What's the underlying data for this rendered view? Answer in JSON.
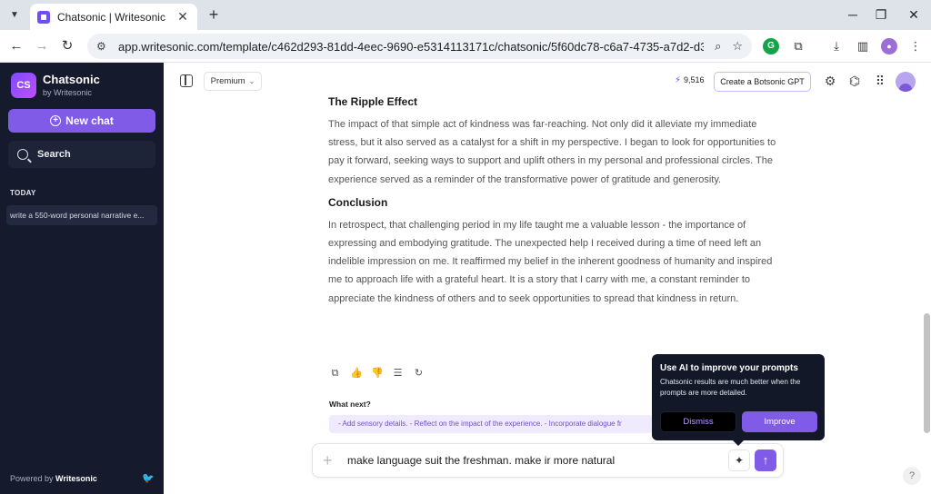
{
  "browser": {
    "tab_title": "Chatsonic | Writesonic",
    "close_glyph": "✕",
    "new_tab_glyph": "+",
    "url": "app.writesonic.com/template/c462d293-81dd-4eec-9690-e5314113171c/chatsonic/5f60dc78-c6a7-4735-a7d2-d399b8594a25?l_...",
    "icons": {
      "tab_list": "chevron-down-icon",
      "back": "arrow-left-icon",
      "forward": "arrow-right-icon",
      "reload": "reload-icon",
      "site_info": "tune-icon",
      "zoom": "search-icon",
      "bookmark": "star-icon",
      "grammarly": "grammarly-icon",
      "extensions": "puzzle-icon",
      "downloads": "download-icon",
      "side_panel": "side-panel-icon",
      "profile": "profile-icon",
      "menu": "kebab-icon"
    }
  },
  "sidebar": {
    "logo": "CS",
    "brand_name": "Chatsonic",
    "brand_sub": "by Writesonic",
    "new_chat_label": "New chat",
    "search_label": "Search",
    "section_today": "TODAY",
    "history": [
      {
        "title": "write a 550-word personal narrative e..."
      }
    ],
    "powered_prefix": "Powered by ",
    "powered_brand": "Writesonic"
  },
  "topbar": {
    "plan_label": "Premium",
    "credits": "9,516",
    "botsonic_label": "Create a Botsonic GPT",
    "icons": [
      "gear-icon",
      "share-icon",
      "apps-grid-icon",
      "avatar"
    ]
  },
  "article": {
    "heading1": "The Ripple Effect",
    "para1": "The impact of that simple act of kindness was far-reaching. Not only did it alleviate my immediate stress, but it also served as a catalyst for a shift in my perspective. I began to look for opportunities to pay it forward, seeking ways to support and uplift others in my personal and professional circles. The experience served as a reminder of the transformative power of gratitude and generosity.",
    "heading2": "Conclusion",
    "para2": "In retrospect, that challenging period in my life taught me a valuable lesson - the importance of expressing and embodying gratitude. The unexpected help I received during a time of need left an indelible impression on me. It reaffirmed my belief in the inherent goodness of humanity and inspired me to approach life with a grateful heart. It is a story that I carry with me, a constant reminder to appreciate the kindness of others and to seek opportunities to spread that kindness in return."
  },
  "response_actions": [
    "copy-icon",
    "thumbs-up-icon",
    "thumbs-down-icon",
    "settings-sliders-icon",
    "regenerate-icon"
  ],
  "what_next": {
    "label": "What next?",
    "suggestion": "- Add sensory details. - Reflect on the impact of the experience. - Incorporate dialogue fr"
  },
  "composer": {
    "value": "make language suit the freshman. make ir more natural"
  },
  "popup": {
    "title": "Use AI to improve your prompts",
    "body": "Chatsonic results are much better when the prompts are more detailed.",
    "dismiss_label": "Dismiss",
    "improve_label": "Improve"
  },
  "help_label": "?"
}
